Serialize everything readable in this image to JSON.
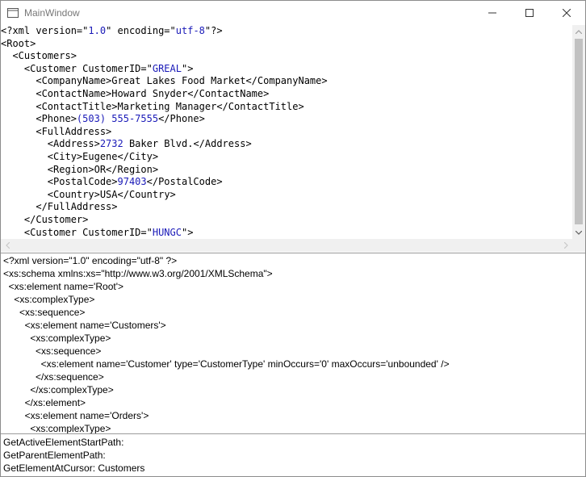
{
  "window": {
    "title": "MainWindow"
  },
  "xml_lines": [
    [
      {
        "t": "<?xml version=\""
      },
      {
        "t": "1.0",
        "v": 1
      },
      {
        "t": "\" encoding=\""
      },
      {
        "t": "utf-8",
        "v": 1
      },
      {
        "t": "\"?>"
      }
    ],
    [
      {
        "t": "<Root>"
      }
    ],
    [
      {
        "t": "  <Customers>"
      }
    ],
    [
      {
        "t": "    <Customer CustomerID=\""
      },
      {
        "t": "GREAL",
        "v": 1
      },
      {
        "t": "\">"
      }
    ],
    [
      {
        "t": "      <CompanyName>"
      },
      {
        "t": "Great Lakes Food Market"
      },
      {
        "t": "</CompanyName>"
      }
    ],
    [
      {
        "t": "      <ContactName>"
      },
      {
        "t": "Howard Snyder"
      },
      {
        "t": "</ContactName>"
      }
    ],
    [
      {
        "t": "      <ContactTitle>"
      },
      {
        "t": "Marketing Manager"
      },
      {
        "t": "</ContactTitle>"
      }
    ],
    [
      {
        "t": "      <Phone>"
      },
      {
        "t": "(503) 555-7555",
        "v": 1
      },
      {
        "t": "</Phone>"
      }
    ],
    [
      {
        "t": "      <FullAddress>"
      }
    ],
    [
      {
        "t": "        <Address>"
      },
      {
        "t": "2732",
        "v": 1
      },
      {
        "t": " Baker Blvd."
      },
      {
        "t": "</Address>"
      }
    ],
    [
      {
        "t": "        <City>"
      },
      {
        "t": "Eugene"
      },
      {
        "t": "</City>"
      }
    ],
    [
      {
        "t": "        <Region>"
      },
      {
        "t": "OR"
      },
      {
        "t": "</Region>"
      }
    ],
    [
      {
        "t": "        <PostalCode>"
      },
      {
        "t": "97403",
        "v": 1
      },
      {
        "t": "</PostalCode>"
      }
    ],
    [
      {
        "t": "        <Country>"
      },
      {
        "t": "USA"
      },
      {
        "t": "</Country>"
      }
    ],
    [
      {
        "t": "      </FullAddress>"
      }
    ],
    [
      {
        "t": "    </Customer>"
      }
    ],
    [
      {
        "t": "    <Customer CustomerID=\""
      },
      {
        "t": "HUNGC",
        "v": 1
      },
      {
        "t": "\">"
      }
    ]
  ],
  "schema_lines": [
    "<?xml version=\"1.0\" encoding=\"utf-8\" ?>",
    "<xs:schema xmlns:xs=\"http://www.w3.org/2001/XMLSchema\">",
    "  <xs:element name='Root'>",
    "    <xs:complexType>",
    "      <xs:sequence>",
    "        <xs:element name='Customers'>",
    "          <xs:complexType>",
    "            <xs:sequence>",
    "              <xs:element name='Customer' type='CustomerType' minOccurs='0' maxOccurs='unbounded' />",
    "            </xs:sequence>",
    "          </xs:complexType>",
    "        </xs:element>",
    "        <xs:element name='Orders'>",
    "          <xs:complexType>"
  ],
  "status": {
    "active_element_start_path": "GetActiveElementStartPath:",
    "parent_element_path": "GetParentElementPath:",
    "element_at_cursor": "GetElementAtCursor: Customers"
  },
  "colors": {
    "value": "#1a1ab8",
    "scrollbar": "#f0f0f0",
    "thumb": "#c1c1c1"
  }
}
